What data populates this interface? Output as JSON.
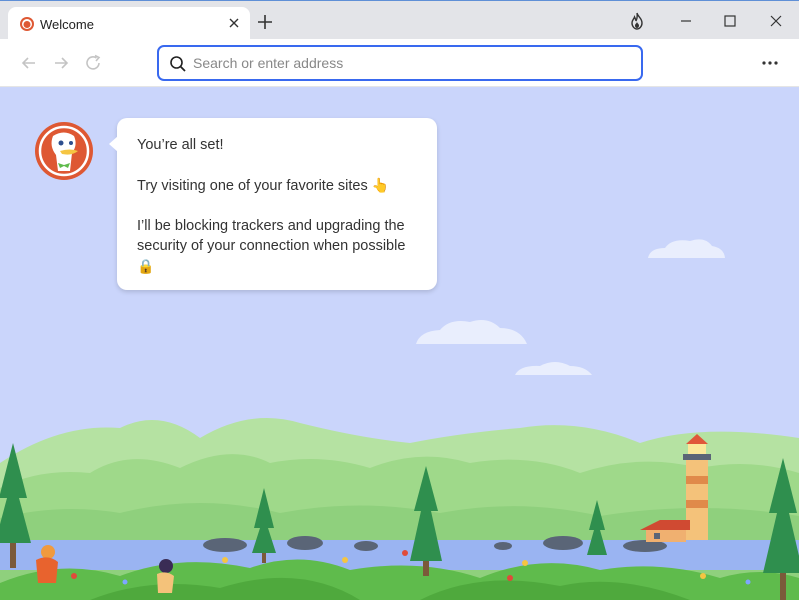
{
  "tab": {
    "title": "Welcome"
  },
  "address_bar": {
    "placeholder": "Search or enter address",
    "value": ""
  },
  "welcome": {
    "line1": "You’re all set!",
    "line2": "Try visiting one of your favorite sites",
    "line2_emoji": "👆",
    "line3": "I’ll be blocking trackers and upgrading the security of your connection when possible",
    "line3_emoji": "🔒"
  },
  "colors": {
    "accent": "#3969ef",
    "brand": "#de5833",
    "sky": "#cad5fb"
  }
}
